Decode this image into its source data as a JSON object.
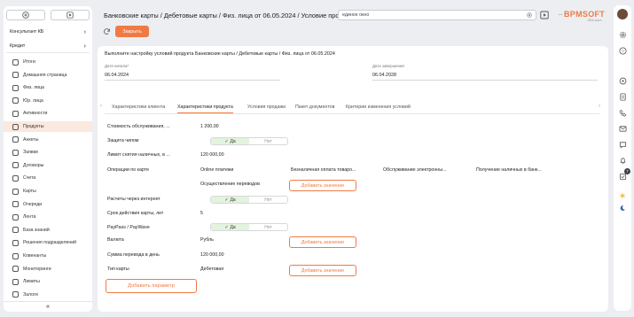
{
  "left": {
    "org_select": "Консультант КБ",
    "product_select": "Кредит",
    "nav_items": [
      {
        "label": "Итоги"
      },
      {
        "label": "Домашняя страница"
      },
      {
        "label": "Физ. лица"
      },
      {
        "label": "Юр. лица"
      },
      {
        "label": "Активности"
      },
      {
        "label": "Продукты"
      },
      {
        "label": "Анкеты"
      },
      {
        "label": "Заявки"
      },
      {
        "label": "Договоры"
      },
      {
        "label": "Счета"
      },
      {
        "label": "Карты"
      },
      {
        "label": "Очереди"
      },
      {
        "label": "Лента"
      },
      {
        "label": "База знаний"
      },
      {
        "label": "Решения подразделений"
      },
      {
        "label": "Ковенанты"
      },
      {
        "label": "Мониторинги"
      },
      {
        "label": "Лимиты"
      },
      {
        "label": "Залоги"
      }
    ],
    "collapse": "«"
  },
  "header": {
    "title": "Банковские карты / Дебетовые карты / Физ. лица от 06.05.2024 / Условие продукта",
    "search_value": "единое окно",
    "close_button": "Закрыть",
    "logo_text": "BPMSOFT",
    "logo_sub": "JIRA.ware"
  },
  "main": {
    "description": "Выполните настройку условий продукта Банковские карты / Дебетовые карты / Физ. лица от 06.05.2024",
    "start_label": "Дата начала*",
    "start_value": "06.04.2024",
    "end_label": "Дата завершения",
    "end_value": "06.04.2028",
    "tabs": [
      "Характеристики клиента",
      "Характеристики продукта",
      "Условия продажи",
      "Пакет документов",
      "Критерии изменения условий"
    ],
    "fields": {
      "cost_label": "Стоимость обслуживания, ...",
      "cost_value": "1 200,00",
      "chip_label": "Защита чипом",
      "yes": "Да",
      "no": "Нет",
      "limit_label": "Лимит снятия наличных, в ...",
      "limit_value": "120 000,00",
      "ops_label": "Операции по карте",
      "ops_values": [
        "Online платежи",
        "Безналичная оплата товаро...",
        "Обслуживание электронны...",
        "Получение наличных в банк..."
      ],
      "ops_value_2": "Осуществление переводов",
      "add_value": "Добавить значение",
      "internet_label": "Расчеты через интернет",
      "term_label": "Срок действия карты, лет",
      "term_value": "5",
      "paypass_label": "PayPass / PayWave",
      "currency_label": "Валюта",
      "currency_value": "Рубль",
      "transfer_label": "Сумма перевода в день",
      "transfer_value": "120 000,00",
      "cardtype_label": "Тип карты",
      "cardtype_value": "Дебетовая",
      "add_param": "Добавить параметр"
    }
  },
  "right": {
    "badge": "7"
  },
  "colors": {
    "accent": "#f07a43",
    "toggle_on": "#e3f3dd",
    "active_nav": "#fbe8df"
  }
}
